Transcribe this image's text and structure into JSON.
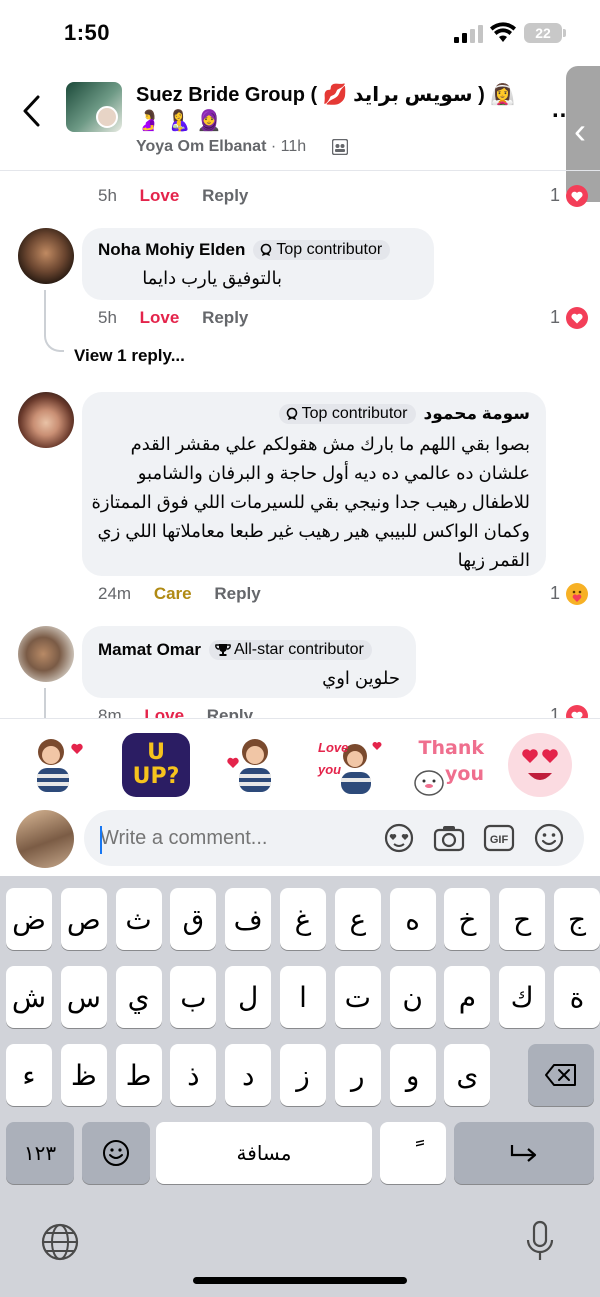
{
  "status_bar": {
    "time": "1:50",
    "battery": "22"
  },
  "header": {
    "title": "Suez Bride Group ( 💋 سويس برايد ) 👰‍♀️ 🤰 🤱 🧕",
    "author": "Yoya Om Elbanat",
    "separator": "·",
    "age": "11h",
    "more": "..."
  },
  "comments": [
    {
      "id": "prev",
      "time": "5h",
      "reaction_label": "Love",
      "reply_label": "Reply",
      "reaction_count": "1",
      "reaction_type": "love"
    },
    {
      "id": "noha",
      "name": "Noha Mohiy Elden",
      "badge": "Top contributor",
      "text": "بالتوفيق يارب دايما",
      "time": "5h",
      "reaction_label": "Love",
      "reply_label": "Reply",
      "reaction_count": "1",
      "reaction_type": "love",
      "view_replies": "View 1 reply..."
    },
    {
      "id": "soma",
      "name": "سومة محمود",
      "badge": "Top contributor",
      "text": "بصوا بقي اللهم ما بارك مش هقولكم علي مقشر القدم علشان ده عالمي ده ديه أول حاجة و البرفان والشامبو للاطفال رهيب جدا ونيجي بقي للسيرمات اللي فوق الممتازة وكمان الواكس للبيبي هير رهيب غير طبعا معاملاتها اللي زي القمر زيها",
      "time": "24m",
      "reaction_label": "Care",
      "reply_label": "Reply",
      "reaction_count": "1",
      "reaction_type": "care"
    },
    {
      "id": "mamat",
      "name": "Mamat Omar",
      "badge": "All-star contributor",
      "text": "حلوين اوي",
      "time": "8m",
      "reaction_label": "Love",
      "reply_label": "Reply",
      "reaction_count": "1",
      "reaction_type": "love"
    }
  ],
  "stickers": [
    {
      "name": "girl-heart-sticker",
      "text": ""
    },
    {
      "name": "u-up-sticker",
      "text": "U UP?"
    },
    {
      "name": "girl-wave-heart-sticker",
      "text": ""
    },
    {
      "name": "love-you-sticker",
      "text": "Love you"
    },
    {
      "name": "thank-you-sticker",
      "text": "Thank you"
    },
    {
      "name": "heart-eyes-sticker",
      "text": ""
    }
  ],
  "composer": {
    "placeholder": "Write a comment..."
  },
  "keyboard": {
    "row1": [
      "ض",
      "ص",
      "ث",
      "ق",
      "ف",
      "غ",
      "ع",
      "ه",
      "خ",
      "ح",
      "ج"
    ],
    "row2": [
      "ش",
      "س",
      "ي",
      "ب",
      "ل",
      "ا",
      "ت",
      "ن",
      "م",
      "ك",
      "ة"
    ],
    "row3": [
      "ء",
      "ظ",
      "ط",
      "ذ",
      "د",
      "ز",
      "ر",
      "و",
      "ى"
    ],
    "numbers_label": "١٢٣",
    "space_label": "مسافة",
    "diacritic_label": "ً"
  },
  "colors": {
    "love": "#e4244b",
    "care": "#b08a13",
    "accent": "#1877f2",
    "bubble": "#f0f2f5",
    "keyboard_bg": "#d1d3d9"
  }
}
